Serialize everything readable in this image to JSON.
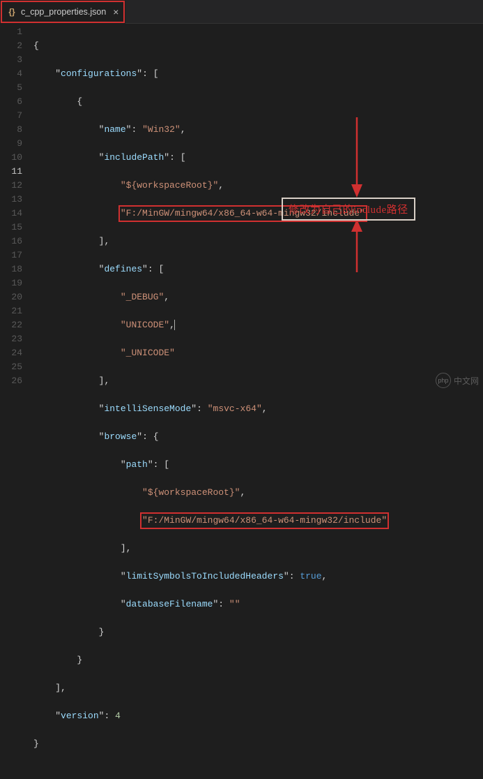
{
  "tab": {
    "filename": "c_cpp_properties.json"
  },
  "callout": {
    "text": "修改为自己的include路径"
  },
  "watermark": {
    "logo": "php",
    "text": "中文网"
  },
  "code": {
    "keys": {
      "configurations": "configurations",
      "name": "name",
      "includePath": "includePath",
      "defines": "defines",
      "intelliSenseMode": "intelliSenseMode",
      "browse": "browse",
      "path": "path",
      "limitSymbolsToIncludedHeaders": "limitSymbolsToIncludedHeaders",
      "databaseFilename": "databaseFilename",
      "version": "version"
    },
    "vals": {
      "name": "Win32",
      "workspaceRoot": "${workspaceRoot}",
      "includePath1": "F:/MinGW/mingw64/x86_64-w64-mingw32/include",
      "define_debug": "_DEBUG",
      "define_unicode": "UNICODE",
      "define__unicode": "_UNICODE",
      "intelliSenseMode": "msvc-x64",
      "limitSymbols": "true",
      "databaseFilename": "",
      "version": "4"
    }
  },
  "punct": {
    "obrace": "{",
    "cbrace": "}",
    "obracket": "[",
    "cbracket": "]",
    "colon": ":",
    "comma": ",",
    "dq": "\""
  }
}
